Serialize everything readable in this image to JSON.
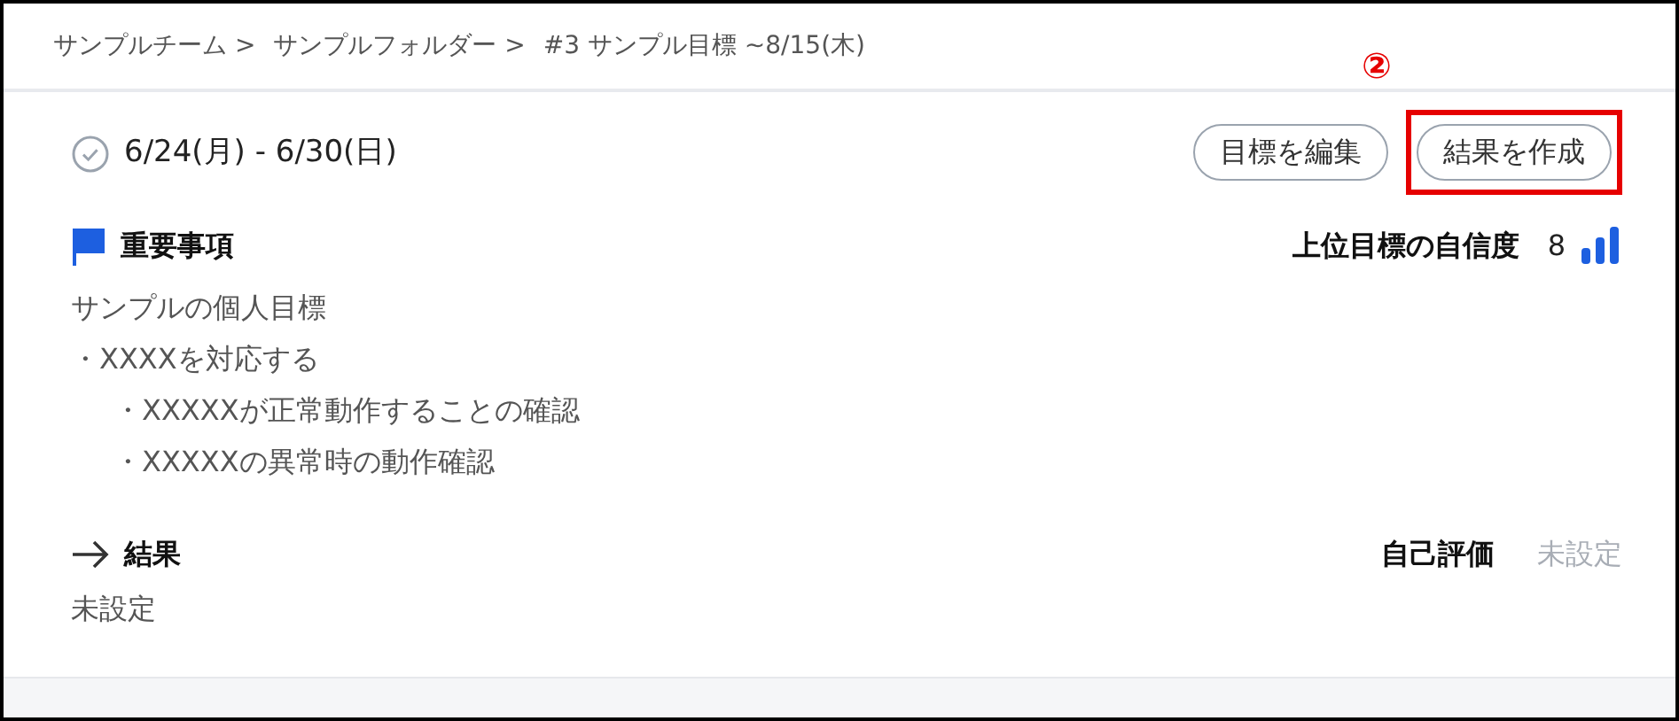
{
  "breadcrumb": [
    "サンプルチーム >",
    "サンプルフォルダー >",
    "#3 サンプル目標 ~8/15(木)"
  ],
  "period": {
    "text": "6/24(月) - 6/30(日)",
    "checked": false
  },
  "buttons": [
    {
      "label": "目標を編集",
      "highlighted": false
    },
    {
      "label": "結果を作成",
      "highlighted": true
    }
  ],
  "annotation": {
    "label": "②"
  },
  "important": {
    "title": "重要事項",
    "confidence_label": "上位目標の自信度",
    "confidence_value": "8",
    "items": [
      {
        "text": "サンプルの個人目標"
      },
      {
        "text": "・XXXXを対応する",
        "children": [
          {
            "text": "・XXXXXが正常動作することの確認"
          },
          {
            "text": "・XXXXXの異常時の動作確認"
          }
        ]
      }
    ]
  },
  "result": {
    "title": "結果",
    "self_eval_label": "自己評価",
    "self_eval_value": "未設定",
    "value": "未設定"
  }
}
